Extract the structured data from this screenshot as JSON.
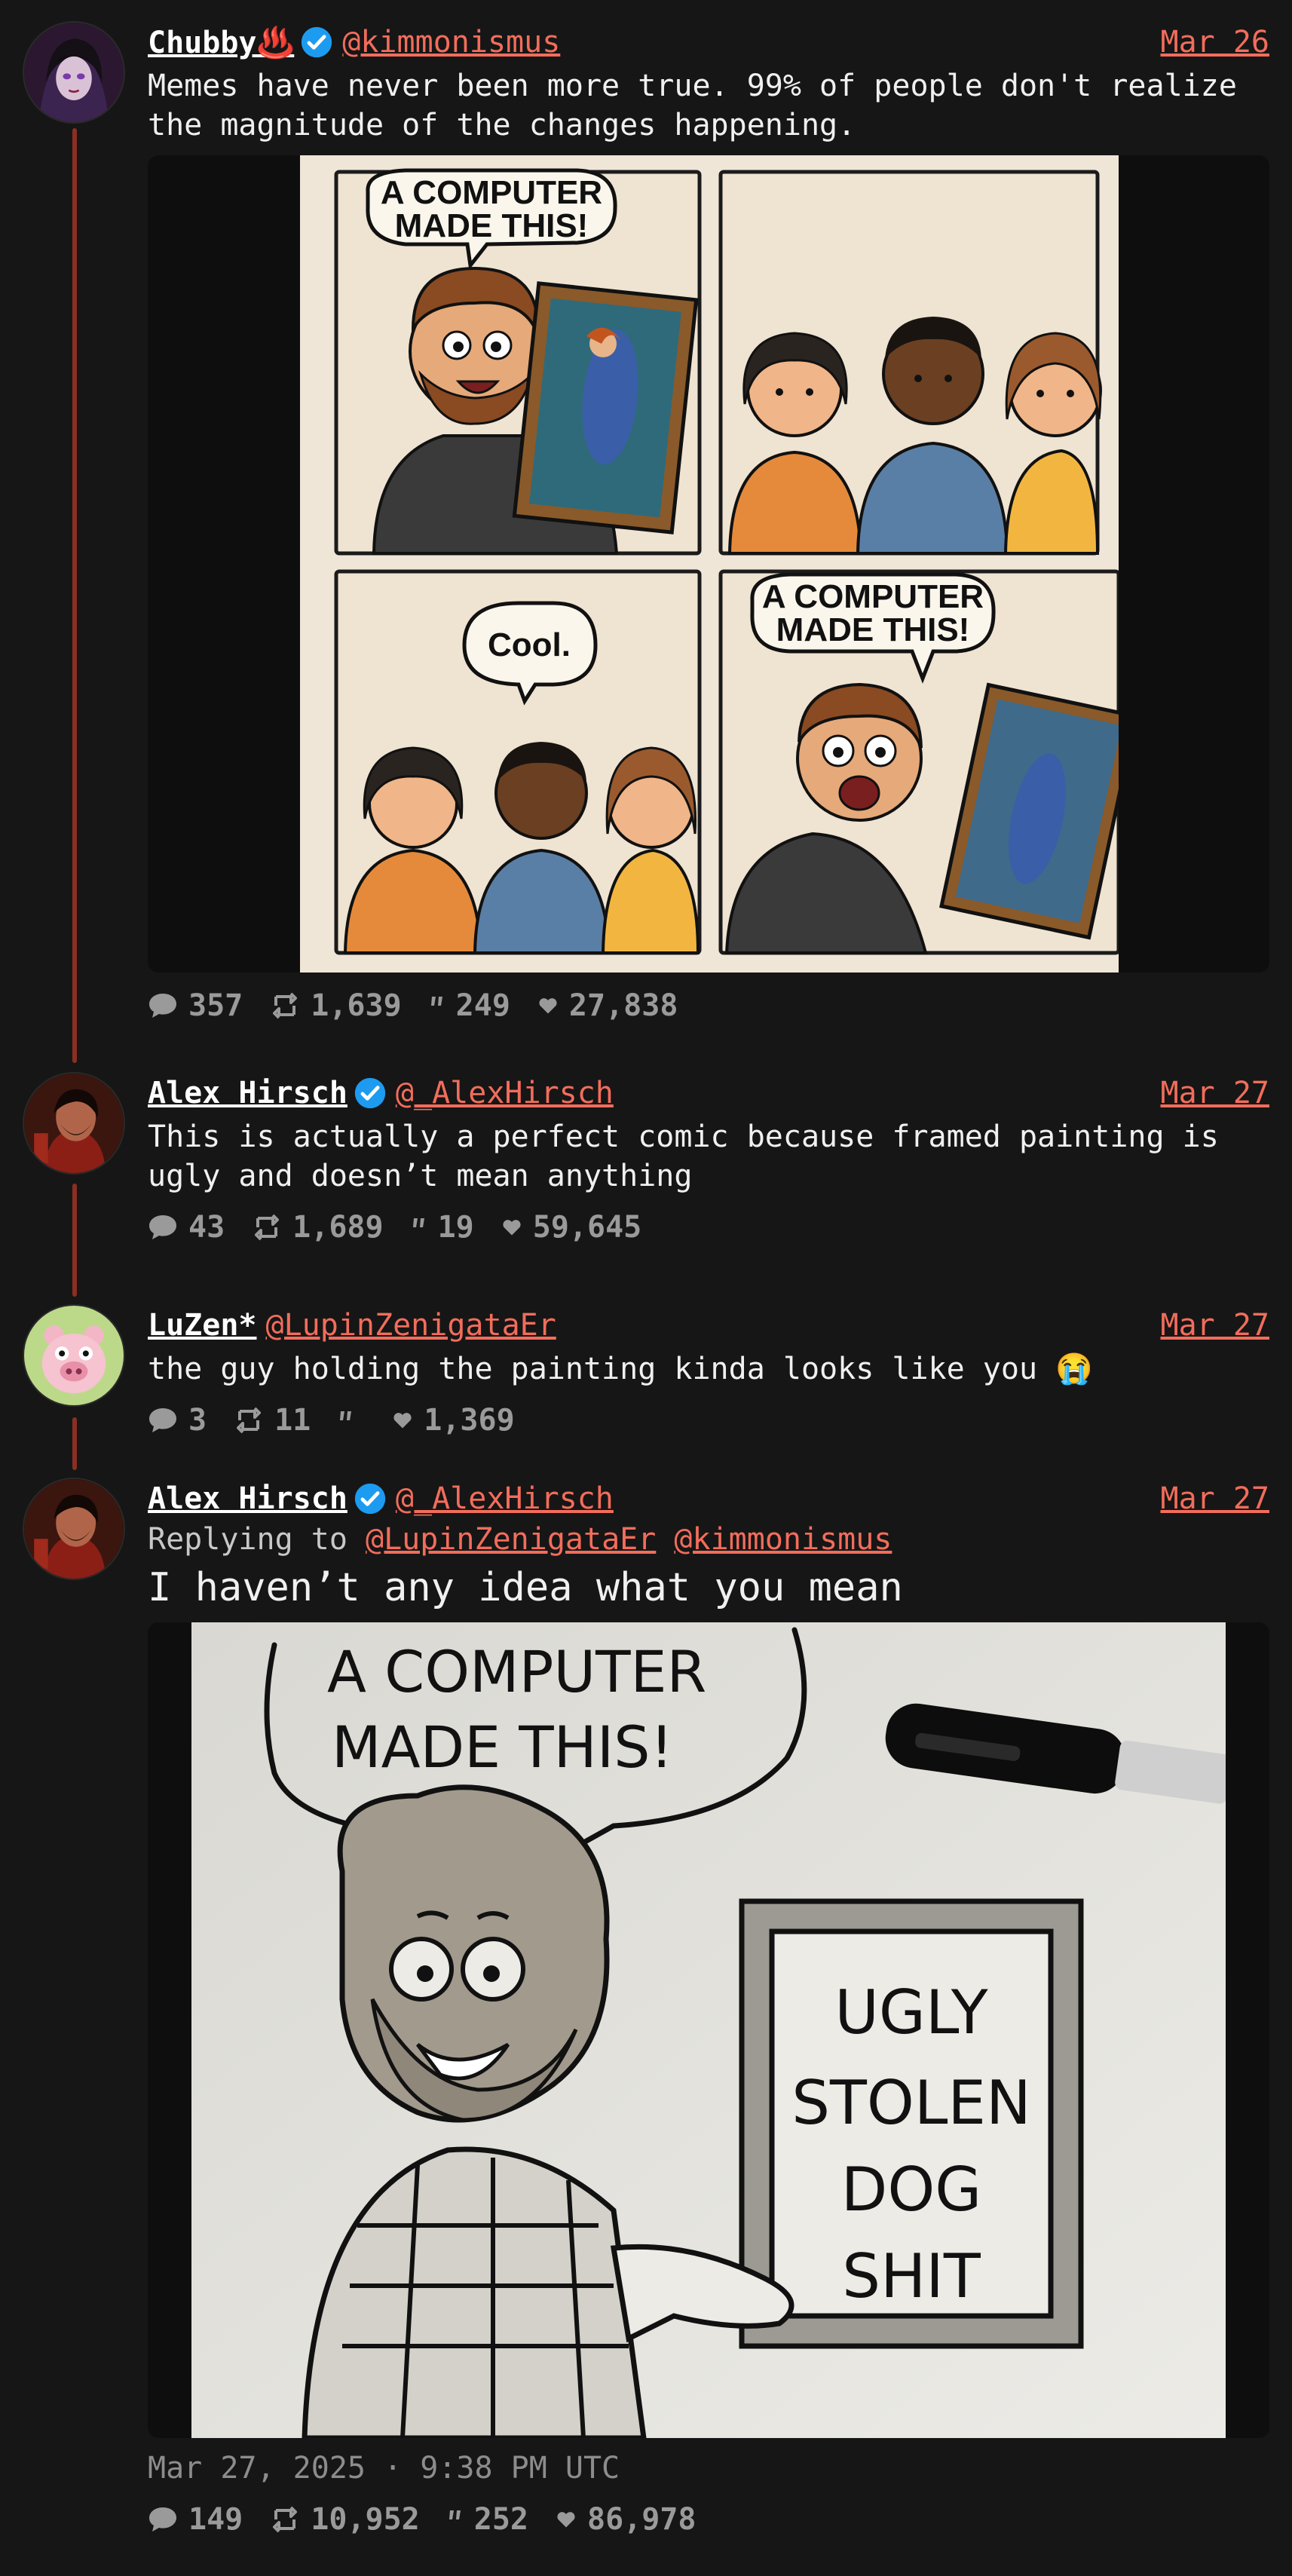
{
  "colors": {
    "background": "#161616",
    "accent": "#f26d5b",
    "thread_line": "#8a2f22",
    "verified": "#1d9bf0",
    "muted": "#9a9a9a"
  },
  "tweets": [
    {
      "name": "Chubby♨️",
      "verified": true,
      "handle": "@kimmonismus",
      "date": "Mar 26",
      "text": "Memes have never been more true. 99% of people don't realize the magnitude of the changes happening.",
      "media": {
        "panel1_speech": [
          "A COMPUTER",
          "MADE THIS!"
        ],
        "panel3_speech": "Cool.",
        "panel4_speech": [
          "A COMPUTER",
          "MADE THIS!"
        ]
      },
      "stats": {
        "replies": "357",
        "reposts": "1,639",
        "quotes": "249",
        "likes": "27,838"
      }
    },
    {
      "name": "Alex Hirsch",
      "verified": true,
      "handle": "@_AlexHirsch",
      "date": "Mar 27",
      "text": "This is actually a perfect comic because framed painting is ugly and doesn’t mean anything",
      "stats": {
        "replies": "43",
        "reposts": "1,689",
        "quotes": "19",
        "likes": "59,645"
      }
    },
    {
      "name": "LuZen*",
      "verified": false,
      "handle": "@LupinZenigataEr",
      "date": "Mar 27",
      "text": "the guy holding the painting kinda looks like you 😭",
      "stats": {
        "replies": "3",
        "reposts": "11",
        "quotes": "",
        "likes": "1,369"
      }
    },
    {
      "name": "Alex Hirsch",
      "verified": true,
      "handle": "@_AlexHirsch",
      "date": "Mar 27",
      "replying_prefix": "Replying to",
      "replying_to": [
        "@LupinZenigataEr",
        "@kimmonismus"
      ],
      "text": "I haven’t any idea what you mean",
      "media": {
        "speech": [
          "A COMPUTER",
          "MADE THIS!"
        ],
        "frame_text": [
          "UGLY",
          "STOLEN",
          "DOG",
          "SHIT"
        ]
      },
      "timestamp": "Mar 27, 2025 · 9:38 PM UTC",
      "stats": {
        "replies": "149",
        "reposts": "10,952",
        "quotes": "252",
        "likes": "86,978"
      }
    }
  ],
  "icons": {
    "reply": "speech-bubble-icon",
    "repost": "repost-icon",
    "quote": "quote-icon",
    "like": "heart-icon",
    "verified": "verified-badge-icon"
  }
}
